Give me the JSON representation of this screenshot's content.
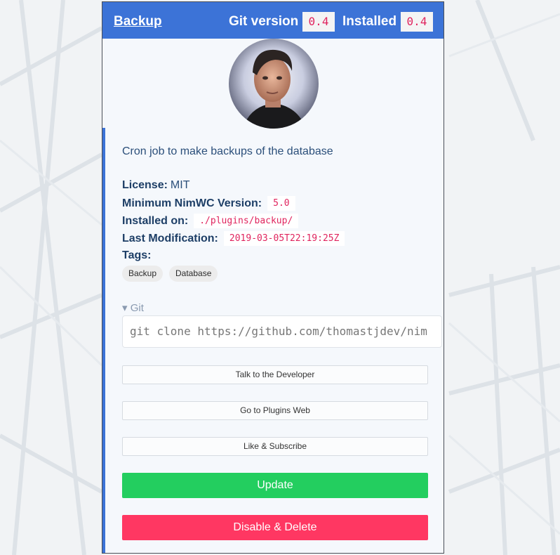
{
  "header": {
    "title": "Backup",
    "git_version_label": "Git version",
    "git_version": "0.4",
    "installed_label": "Installed",
    "installed_version": "0.4"
  },
  "description": "Cron job to make backups of the database",
  "details": {
    "license_label": "License:",
    "license_value": "MIT",
    "min_version_label": "Minimum NimWC Version:",
    "min_version_value": "5.0",
    "installed_on_label": "Installed on:",
    "installed_on_value": "./plugins/backup/",
    "last_mod_label": "Last Modification:",
    "last_mod_value": "2019-03-05T22:19:25Z",
    "tags_label": "Tags:",
    "tags": [
      "Backup",
      "Database"
    ]
  },
  "git": {
    "summary": "Git",
    "clone_command": "git clone https://github.com/thomastjdev/nim"
  },
  "buttons": {
    "talk": "Talk to the Developer",
    "web": "Go to Plugins Web",
    "like": "Like & Subscribe",
    "update": "Update",
    "delete": "Disable & Delete"
  },
  "colors": {
    "header": "#3c73d7",
    "update": "#23ce5f",
    "delete": "#ff3762",
    "code": "#e0245e"
  },
  "icons": {
    "disclosure": "triangle-down-icon"
  }
}
